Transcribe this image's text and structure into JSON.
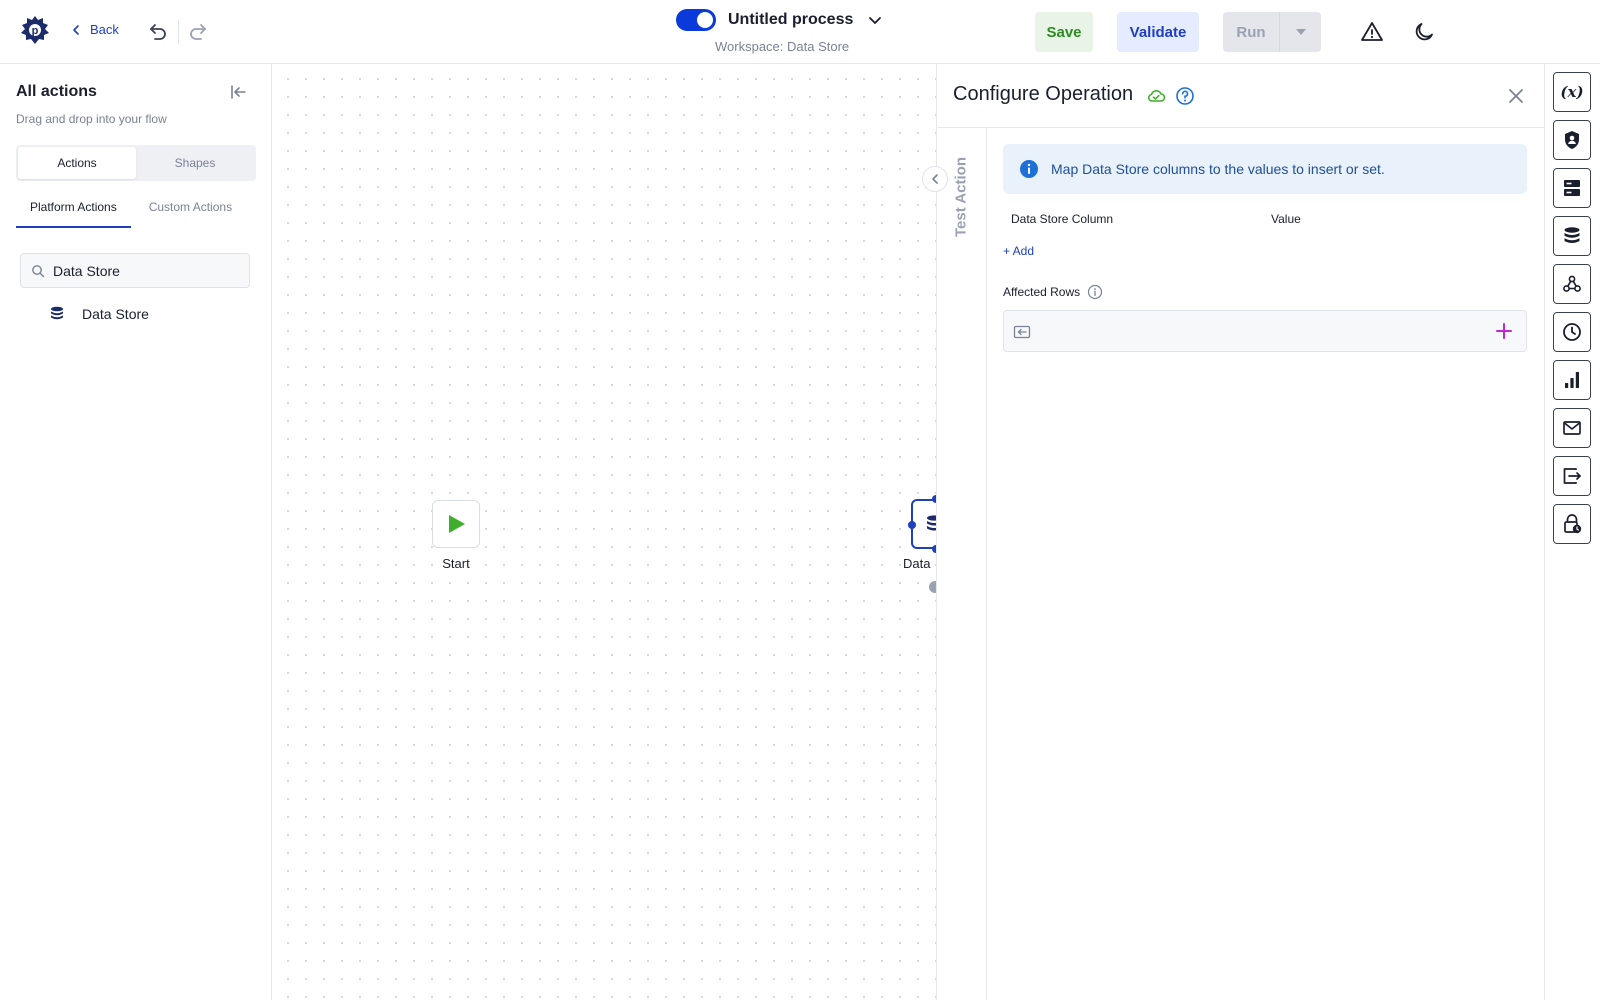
{
  "header": {
    "back_label": "Back",
    "process_title": "Untitled process",
    "workspace": "Workspace: Data Store",
    "save_label": "Save",
    "validate_label": "Validate",
    "run_label": "Run",
    "toggle_enabled": true
  },
  "sidebar": {
    "title": "All actions",
    "subtitle": "Drag and drop into your flow",
    "segments": [
      "Actions",
      "Shapes"
    ],
    "active_segment": "Actions",
    "tabs": [
      "Platform Actions",
      "Custom Actions"
    ],
    "active_tab": "Platform Actions",
    "search_value": "Data Store",
    "results": [
      {
        "label": "Data Store",
        "icon": "database-icon"
      }
    ]
  },
  "canvas": {
    "start_label": "Start",
    "datastore_label": "Data"
  },
  "panel": {
    "title": "Configure Operation",
    "vertical_tab": "Test Action",
    "info_text": "Map Data Store columns to the values to insert or set.",
    "col_ds": "Data Store Column",
    "col_val": "Value",
    "add_label": "+ Add",
    "affected_label": "Affected Rows"
  },
  "rail": {
    "variables_label": "(x)",
    "icons": [
      "variables-icon",
      "shield-user-icon",
      "server-icon",
      "database-icon",
      "webhook-icon",
      "clock-icon",
      "bar-chart-icon",
      "mail-icon",
      "export-icon",
      "lock-clock-icon"
    ]
  },
  "colors": {
    "primary": "#1f3fbf",
    "toggle": "#0a3ad9",
    "save_bg": "#e8f4e6",
    "save_text": "#2d8a25",
    "validate_bg": "#e5ecff",
    "run_bg": "#e4e6ec",
    "start_green": "#3fae2a",
    "info_bg": "#e9f1fb",
    "plus_magenta": "#c026d3"
  }
}
